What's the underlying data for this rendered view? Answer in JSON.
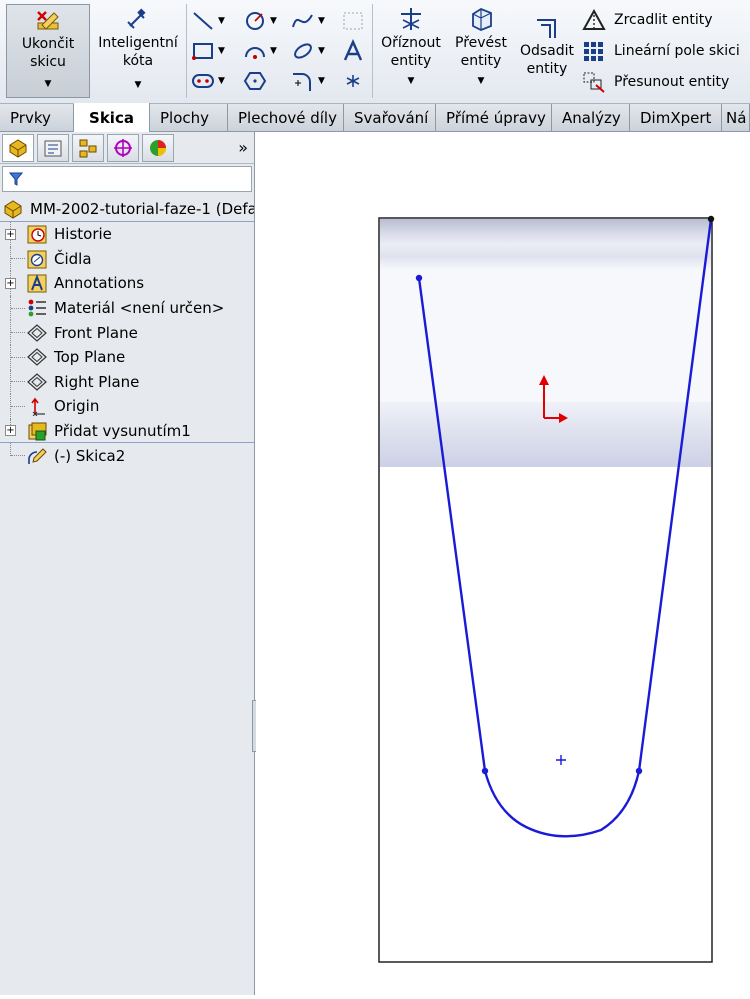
{
  "ribbon": {
    "exit_sketch": {
      "line1": "Ukončit",
      "line2": "skicu"
    },
    "smart_dim": {
      "line1": "Inteligentní",
      "line2": "kóta"
    },
    "trim": {
      "line1": "Oříznout",
      "line2": "entity"
    },
    "convert": {
      "line1": "Převést",
      "line2": "entity"
    },
    "offset": {
      "line1": "Odsadit",
      "line2": "entity"
    },
    "mirror": "Zrcadlit entity",
    "linear_pattern": "Lineární pole skici",
    "move": "Přesunout entity"
  },
  "tabs": [
    "Prvky",
    "Skica",
    "Plochy",
    "Plechové díly",
    "Svařování",
    "Přímé úpravy",
    "Analýzy",
    "DimXpert",
    "Ná"
  ],
  "active_tab": "Skica",
  "panel": {
    "more": "»",
    "root": "MM-2002-tutorial-faze-1  (Defa",
    "items": [
      {
        "label": "Historie",
        "icon": "history-icon"
      },
      {
        "label": "Čidla",
        "icon": "sensors-icon"
      },
      {
        "label": "Annotations",
        "icon": "annotations-icon"
      },
      {
        "label": "Materiál <není určen>",
        "icon": "material-icon"
      },
      {
        "label": "Front Plane",
        "icon": "plane-icon"
      },
      {
        "label": "Top Plane",
        "icon": "plane-icon"
      },
      {
        "label": "Right Plane",
        "icon": "plane-icon"
      },
      {
        "label": "Origin",
        "icon": "origin-icon"
      },
      {
        "label": "Přidat vysunutím1",
        "icon": "extrude-icon"
      },
      {
        "label": "(-) Skica2",
        "icon": "sketch-icon"
      }
    ]
  },
  "colors": {
    "sketch_line": "#1a1ad8",
    "origin_red": "#e00000",
    "highlight": "#8ea1c9"
  }
}
